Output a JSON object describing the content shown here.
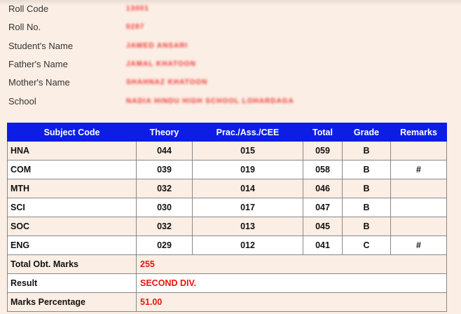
{
  "info": [
    {
      "label": "Roll Code",
      "value": "13001"
    },
    {
      "label": "Roll No.",
      "value": "0287"
    },
    {
      "label": "Student's Name",
      "value": "JAWED ANSARI"
    },
    {
      "label": "Father's Name",
      "value": "JAMAL KHATOON"
    },
    {
      "label": "Mother's Name",
      "value": "SHAHNAZ KHATOON"
    },
    {
      "label": "School",
      "value": "NADIA HINDU HIGH SCHOOL LOHARDAGA"
    }
  ],
  "table": {
    "headers": [
      "Subject Code",
      "Theory",
      "Prac./Ass./CEE",
      "Total",
      "Grade",
      "Remarks"
    ],
    "rows": [
      {
        "subject": "HNA",
        "theory": "044",
        "practical": "015",
        "total": "059",
        "grade": "B",
        "remarks": ""
      },
      {
        "subject": "COM",
        "theory": "039",
        "practical": "019",
        "total": "058",
        "grade": "B",
        "remarks": "#"
      },
      {
        "subject": "MTH",
        "theory": "032",
        "practical": "014",
        "total": "046",
        "grade": "B",
        "remarks": ""
      },
      {
        "subject": "SCI",
        "theory": "030",
        "practical": "017",
        "total": "047",
        "grade": "B",
        "remarks": ""
      },
      {
        "subject": "SOC",
        "theory": "032",
        "practical": "013",
        "total": "045",
        "grade": "B",
        "remarks": ""
      },
      {
        "subject": "ENG",
        "theory": "029",
        "practical": "012",
        "total": "041",
        "grade": "C",
        "remarks": "#"
      }
    ],
    "summary": [
      {
        "label": "Total Obt. Marks",
        "value": "255"
      },
      {
        "label": "Result",
        "value": "SECOND DIV."
      },
      {
        "label": "Marks Percentage",
        "value": "51.00"
      }
    ]
  },
  "colors": {
    "header_bg": "#0c1de6",
    "page_bg": "#fbeee4",
    "highlight_text": "#ee1111"
  }
}
